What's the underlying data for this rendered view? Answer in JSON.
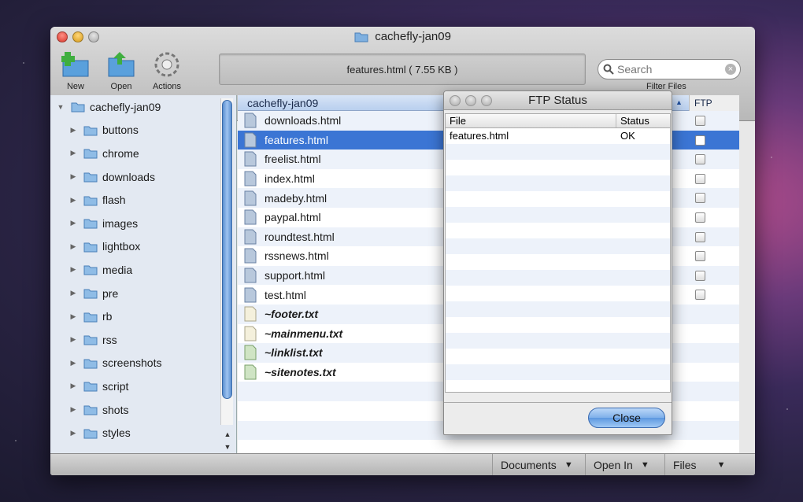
{
  "window": {
    "title": "cachefly-jan09",
    "toolbar": {
      "new_label": "New",
      "open_label": "Open",
      "actions_label": "Actions"
    },
    "status_text": "features.html ( 7.55 KB )",
    "search": {
      "placeholder": "Search",
      "filter_label": "Filter Files"
    }
  },
  "sidebar": {
    "root": "cachefly-jan09",
    "items": [
      "buttons",
      "chrome",
      "downloads",
      "flash",
      "images",
      "lightbox",
      "media",
      "pre",
      "rb",
      "rss",
      "screenshots",
      "script",
      "shots",
      "styles"
    ]
  },
  "filelist": {
    "header": "cachefly-jan09",
    "ftp_column": "FTP",
    "rows": [
      {
        "name": "downloads.html",
        "kind": "html"
      },
      {
        "name": "features.html",
        "kind": "html"
      },
      {
        "name": "freelist.html",
        "kind": "html"
      },
      {
        "name": "index.html",
        "kind": "html"
      },
      {
        "name": "madeby.html",
        "kind": "html"
      },
      {
        "name": "paypal.html",
        "kind": "html"
      },
      {
        "name": "roundtest.html",
        "kind": "html"
      },
      {
        "name": "rssnews.html",
        "kind": "html"
      },
      {
        "name": "support.html",
        "kind": "html"
      },
      {
        "name": "test.html",
        "kind": "html"
      },
      {
        "name": "~footer.txt",
        "kind": "txt"
      },
      {
        "name": "~mainmenu.txt",
        "kind": "txt"
      },
      {
        "name": "~linklist.txt",
        "kind": "txt-green"
      },
      {
        "name": "~sitenotes.txt",
        "kind": "txt-green"
      }
    ],
    "selected_index": 1
  },
  "bottombar": {
    "documents_label": "Documents",
    "openin_label": "Open In",
    "files_label": "Files"
  },
  "ftp_dialog": {
    "title": "FTP Status",
    "col_file": "File",
    "col_status": "Status",
    "rows": [
      {
        "file": "features.html",
        "status": "OK"
      }
    ],
    "close_label": "Close"
  }
}
